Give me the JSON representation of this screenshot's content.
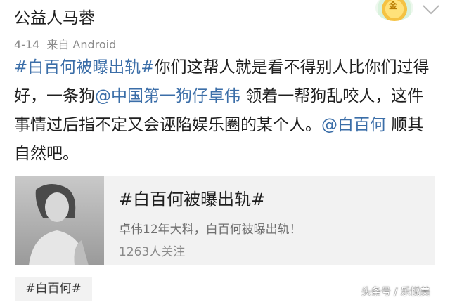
{
  "post": {
    "author": "公益人马蓉",
    "date": "4-14",
    "source": "来自 Android",
    "segments": [
      {
        "text": "#白百何被曝出轨#",
        "type": "link"
      },
      {
        "text": "你们这帮人就是看不得别人比你们过得好，一条狗",
        "type": "text"
      },
      {
        "text": "@中国第一狗仔卓伟",
        "type": "link"
      },
      {
        "text": " 领着一帮狗乱咬人，这件事情过后指不定又会诬陷娱乐圈的某个人。",
        "type": "text"
      },
      {
        "text": "@白百何",
        "type": "link"
      },
      {
        "text": " 顺其自然吧。",
        "type": "text"
      }
    ]
  },
  "card": {
    "title": "#白百何被曝出轨#",
    "description": "卓伟12年大料，白百何被曝出轨！",
    "followers": "1263人关注"
  },
  "tag": "#白百何#",
  "watermark": "头条号 / 乐悦美",
  "icons": {
    "badge": "gold-medal-badge-icon",
    "menu": "chevron-down-icon"
  },
  "badge_mark": "金",
  "colors": {
    "link": "#3b6ea8",
    "card_bg": "#f2f2f2",
    "meta": "#8a8a8a"
  }
}
